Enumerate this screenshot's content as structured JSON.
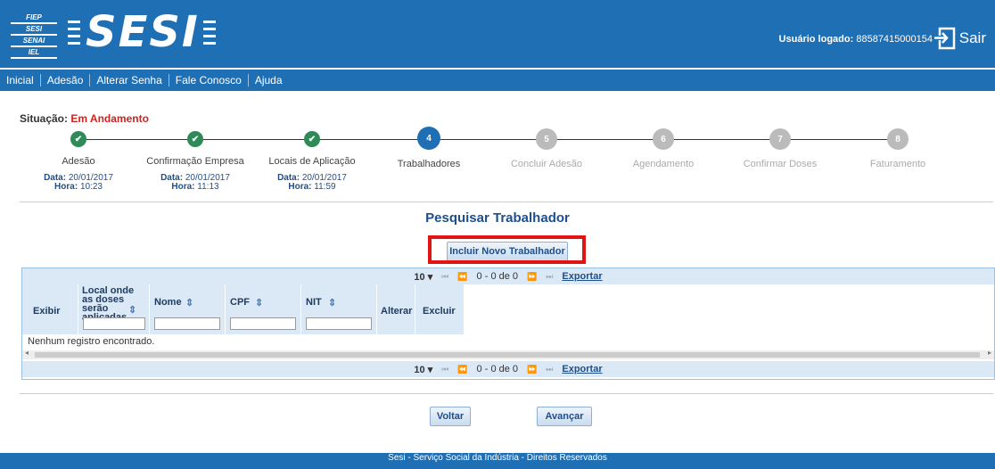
{
  "header": {
    "logo_lines": [
      "FIEP",
      "SESI",
      "SENAI",
      "IEL"
    ],
    "brand": "SESI",
    "user_label": "Usuário logado:",
    "user_value": "88587415000154",
    "logout_label": "Sair"
  },
  "nav": [
    "Inicial",
    "Adesão",
    "Alterar Senha",
    "Fale Conosco",
    "Ajuda"
  ],
  "status": {
    "label": "Situação:",
    "value": "Em Andamento"
  },
  "steps": [
    {
      "label": "Adesão",
      "state": "done",
      "date_label": "Data:",
      "date": "20/01/2017",
      "time_label": "Hora:",
      "time": "10:23"
    },
    {
      "label": "Confirmação Empresa",
      "state": "done",
      "date_label": "Data:",
      "date": "20/01/2017",
      "time_label": "Hora:",
      "time": "11:13"
    },
    {
      "label": "Locais de Aplicação",
      "state": "done",
      "date_label": "Data:",
      "date": "20/01/2017",
      "time_label": "Hora:",
      "time": "11:59"
    },
    {
      "label": "Trabalhadores",
      "state": "current",
      "number": "4"
    },
    {
      "label": "Concluir Adesão",
      "state": "future",
      "number": "5"
    },
    {
      "label": "Agendamento",
      "state": "future",
      "number": "6"
    },
    {
      "label": "Confirmar Doses",
      "state": "future",
      "number": "7"
    },
    {
      "label": "Faturamento",
      "state": "future",
      "number": "8"
    }
  ],
  "page_title": "Pesquisar Trabalhador",
  "add_button": "Incluir Novo Trabalhador",
  "table": {
    "rows_per_page": "10",
    "page_info": "0 - 0 de 0",
    "export_label": "Exportar",
    "columns": {
      "exibir": "Exibir",
      "local": "Local onde as doses serão aplicadas",
      "nome": "Nome",
      "cpf": "CPF",
      "nit": "NIT",
      "alterar": "Alterar",
      "excluir": "Excluir"
    },
    "empty_message": "Nenhum registro encontrado."
  },
  "buttons": {
    "back": "Voltar",
    "next": "Avançar"
  },
  "footer": {
    "line1": "Sesi - Serviço Social da Indústria - Direitos Reservados",
    "line2": ""
  },
  "colors": {
    "brand_blue": "#1f6fb5",
    "done_green": "#2e8b57",
    "status_red": "#d31f1f",
    "highlight_red": "#e21313"
  }
}
